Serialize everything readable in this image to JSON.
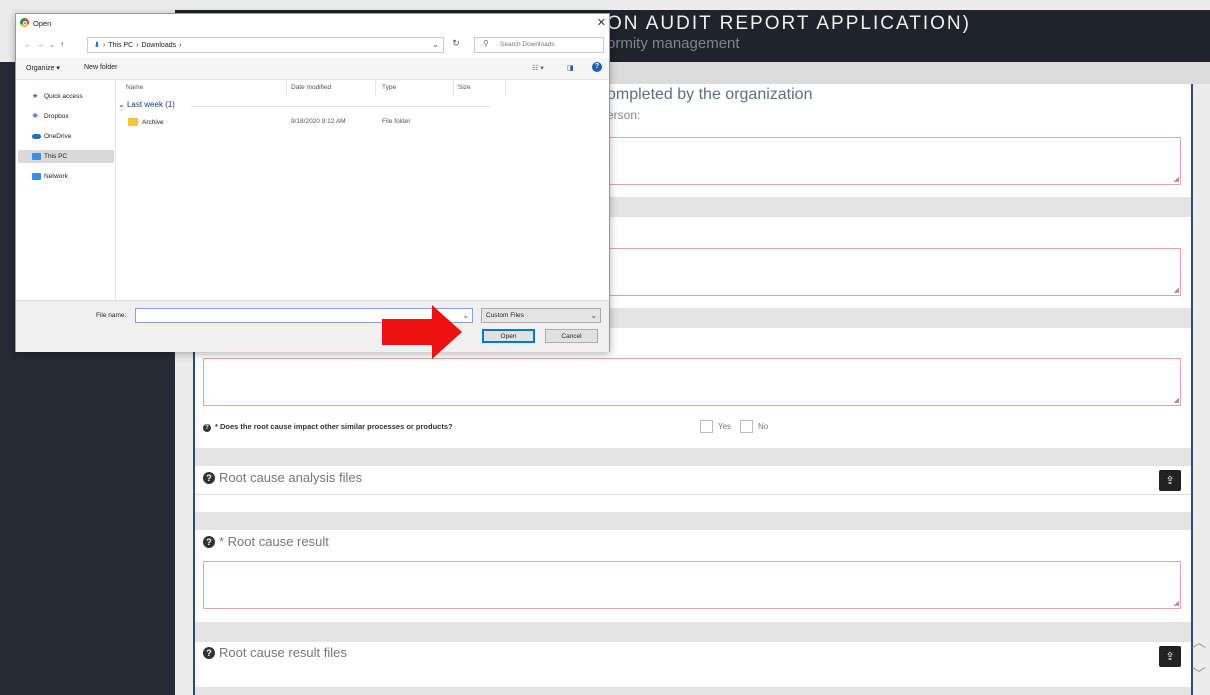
{
  "app": {
    "header_title": "ON AUDIT REPORT APPLICATION)",
    "header_subtitle": "ormity management"
  },
  "form": {
    "section_title": "ompleted by the organization",
    "section_subtitle": "erson:",
    "question_similar": "* Does the root cause impact other similar processes or products?",
    "yes_label": "Yes",
    "no_label": "No",
    "rca_files_label": "Root cause analysis files",
    "result_label": "* Root cause result",
    "result_files_label": "Root cause result files"
  },
  "dialog": {
    "title": "Open",
    "breadcrumb": [
      "This PC",
      "Downloads"
    ],
    "search_placeholder": "Search Downloads",
    "organize_label": "Organize ▾",
    "new_folder_label": "New folder",
    "nav_items": [
      {
        "label": "Quick access",
        "icon": "star-icon",
        "color": "#1a6fd1"
      },
      {
        "label": "Dropbox",
        "icon": "dropbox-icon",
        "color": "#2a62d6"
      },
      {
        "label": "OneDrive",
        "icon": "cloud-icon",
        "color": "#1a73c9"
      },
      {
        "label": "This PC",
        "icon": "computer-icon",
        "color": "#3a8ee6"
      },
      {
        "label": "Network",
        "icon": "network-icon",
        "color": "#3a8ee6"
      }
    ],
    "columns": [
      "Name",
      "Date modified",
      "Type",
      "Size"
    ],
    "group_label": "Last week (1)",
    "files": [
      {
        "name": "Archive",
        "date": "9/18/2020 9:12 AM",
        "type": "File folder",
        "size": ""
      }
    ],
    "file_name_label": "File name:",
    "file_name_value": "",
    "file_type": "Custom Files",
    "open_label": "Open",
    "cancel_label": "Cancel"
  },
  "colors": {
    "annotation_arrow": "#ee1111",
    "sidebar": "#262a33",
    "accent": "#2e4a7a"
  }
}
